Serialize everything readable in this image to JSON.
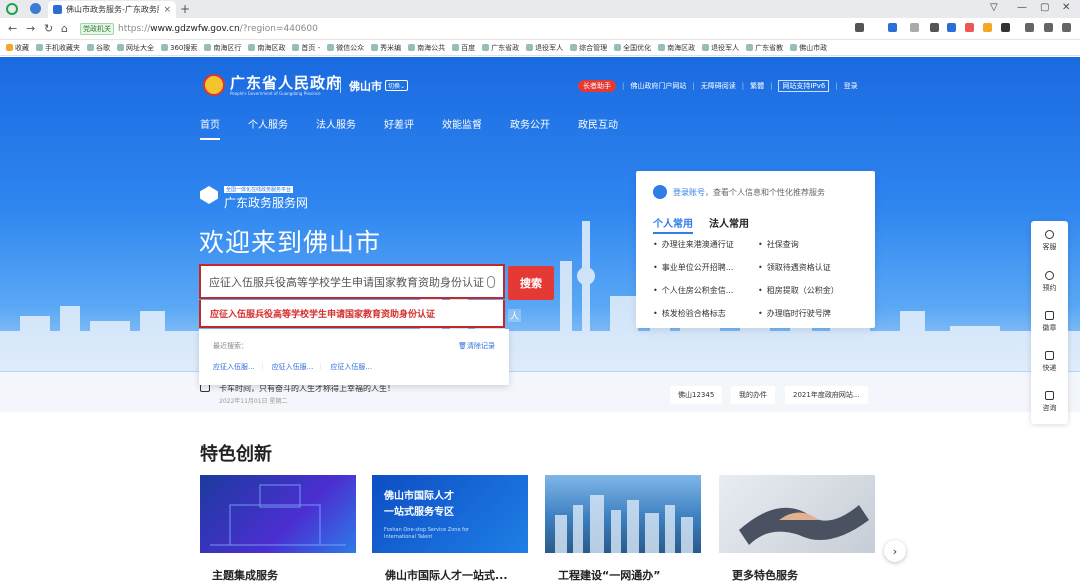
{
  "browser": {
    "tab_title": "佛山市政务服务-广东政务服务",
    "tab_close": "×",
    "new_tab": "+",
    "url_prefix": "https://",
    "url_host": "www.gdzwfw.gov.cn",
    "url_path": "/?region=440600",
    "gov_badge": "党政机关",
    "bookmarks": [
      "收藏",
      "手机收藏夹",
      "谷歌",
      "网址大全",
      "360搜索",
      "南海区行",
      "南海区政",
      "首页 -",
      "微信公众",
      "秀米编",
      "南海公共",
      "百度",
      "广东省政",
      "退役军人",
      "综合管理",
      "全国优化",
      "南海区政",
      "退役军人",
      "广东省教",
      "佛山市政"
    ]
  },
  "header": {
    "site_title": "广东省人民政府",
    "site_subtitle": "People's Government of Guangdong Province",
    "city": "佛山市",
    "city_switch": "切换",
    "elder_mode": "长者助手",
    "links": [
      "佛山政府门户网站",
      "无障碍阅读",
      "繁體",
      "网站支持IPv6",
      "登录"
    ]
  },
  "nav": [
    "首页",
    "个人服务",
    "法人服务",
    "好差评",
    "效能监督",
    "政务公开",
    "政民互动"
  ],
  "hero": {
    "hub_tag": "全国一体化在线政务服务平台",
    "hub_name": "广东政务服务网",
    "welcome": "欢迎来到佛山市",
    "search_placeholder": "应征入伍服兵役高等学校学生申请国家教育资助身份认证",
    "search_button": "搜索",
    "suggestion": "应征入伍服兵役高等学校学生申请国家教育资助身份认证",
    "partial_tag": "人",
    "recent_label": "最近搜索：",
    "recent_clear": "清除记录",
    "recent_items": [
      "应征入伍服...",
      "应征入伍服...",
      "应征入伍服..."
    ]
  },
  "login_card": {
    "login_link": "登录账号",
    "login_hint": "，查看个人信息和个性化推荐服务",
    "tabs": [
      "个人常用",
      "法人常用"
    ],
    "services": [
      "办理往来港澳通行证",
      "社保查询",
      "事业单位公开招聘...",
      "领取待遇资格认证",
      "个人住房公积金信...",
      "租房提取（公积金）",
      "核发检验合格标志",
      "办理临时行驶号牌"
    ]
  },
  "notice": {
    "text": "卡车时间，只有奋斗的人生才称得上幸福的人生！",
    "date": "2022年11月01日 星期二",
    "quick_links": [
      "佛山12345",
      "我的办件",
      "2021年度政府网站..."
    ]
  },
  "features": {
    "title": "特色创新",
    "cards": [
      "主题集成服务",
      "佛山市国际人才一站式...",
      "工程建设“一网通办”",
      "更多特色服务"
    ],
    "card2_headline_1": "佛山市国际人才",
    "card2_headline_2": "一站式服务专区",
    "card2_en_1": "Foshan One-stop Service Zone for",
    "card2_en_2": "International Talent",
    "next": "›"
  },
  "sidebar": [
    "客服",
    "预约",
    "徽章",
    "快递",
    "咨询"
  ],
  "colors": {
    "primary": "#2f7de6",
    "accent_red": "#e53935"
  }
}
